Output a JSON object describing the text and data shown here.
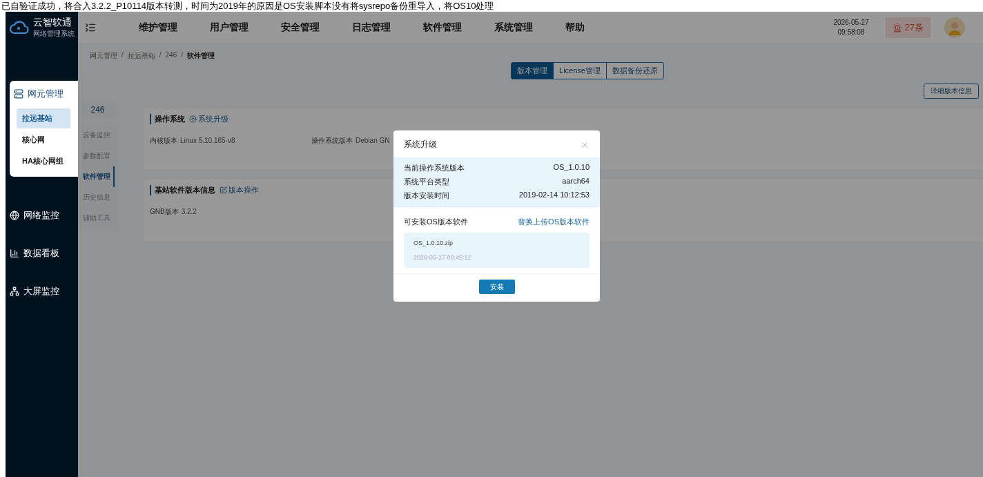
{
  "caption": "已自验证成功，将合入3.2.2_P10114版本转测，时间为2019年的原因是OS安装脚本没有将sysrepo备份重导入，将OS10处理",
  "brand": {
    "name": "云智软通",
    "subtitle": "网络管理系统"
  },
  "topnav": [
    "维护管理",
    "用户管理",
    "安全管理",
    "日志管理",
    "软件管理",
    "系统管理",
    "帮助"
  ],
  "datetime": {
    "date": "2026-05-27",
    "time": "09:58:08"
  },
  "alarm": {
    "count": "27条"
  },
  "breadcrumb": {
    "separator": "/",
    "items": [
      "网元管理",
      "拉远基站",
      "246",
      "软件管理"
    ]
  },
  "tabs": [
    {
      "label": "版本管理",
      "selected": true
    },
    {
      "label": "License管理",
      "selected": false
    },
    {
      "label": "数据备份还原",
      "selected": false
    }
  ],
  "detail_button": "详细版本信息",
  "sidebar": [
    {
      "label": "网元管理",
      "kind": "server",
      "expanded": true,
      "children": [
        {
          "label": "拉远基站",
          "selected": true
        },
        {
          "label": "核心网",
          "selected": false
        },
        {
          "label": "HA核心网组",
          "selected": false
        }
      ]
    },
    {
      "label": "网络监控",
      "kind": "globe",
      "expanded": false
    },
    {
      "label": "数据看板",
      "kind": "chart",
      "expanded": false
    },
    {
      "label": "大屏监控",
      "kind": "nodes",
      "expanded": false
    }
  ],
  "device": {
    "name": "246",
    "menu": [
      {
        "label": "设备监控",
        "selected": false
      },
      {
        "label": "参数配置",
        "selected": false
      },
      {
        "label": "软件管理",
        "selected": true
      },
      {
        "label": "历史信息",
        "selected": false
      },
      {
        "label": "辅助工具",
        "selected": false
      }
    ]
  },
  "cards": [
    {
      "title": "操作系统",
      "action": "系统升级",
      "kind": "upgrade",
      "fields": [
        {
          "label": "内核版本",
          "value": "Linux 5.10.165-v8"
        },
        {
          "label": "操作系统版本",
          "value": "Debian GN"
        }
      ]
    },
    {
      "title": "基站软件版本信息",
      "action": "版本操作",
      "kind": "edit",
      "fields": [
        {
          "label": "GNB版本",
          "value": "3.2.2"
        }
      ]
    }
  ],
  "modal": {
    "title": "系统升级",
    "info": [
      {
        "label": "当前操作系统版本",
        "value": "OS_1.0.10"
      },
      {
        "label": "系统平台类型",
        "value": "aarch64"
      },
      {
        "label": "版本安装时间",
        "value": "2019-02-14 10:12:53"
      }
    ],
    "package_label": "可安装OS版本软件",
    "replace_link": "替换上传OS版本软件",
    "files": [
      {
        "name": "OS_1.0.10.zip",
        "time": "2026-05-27 09:45:12"
      }
    ],
    "install_button": "安装"
  }
}
